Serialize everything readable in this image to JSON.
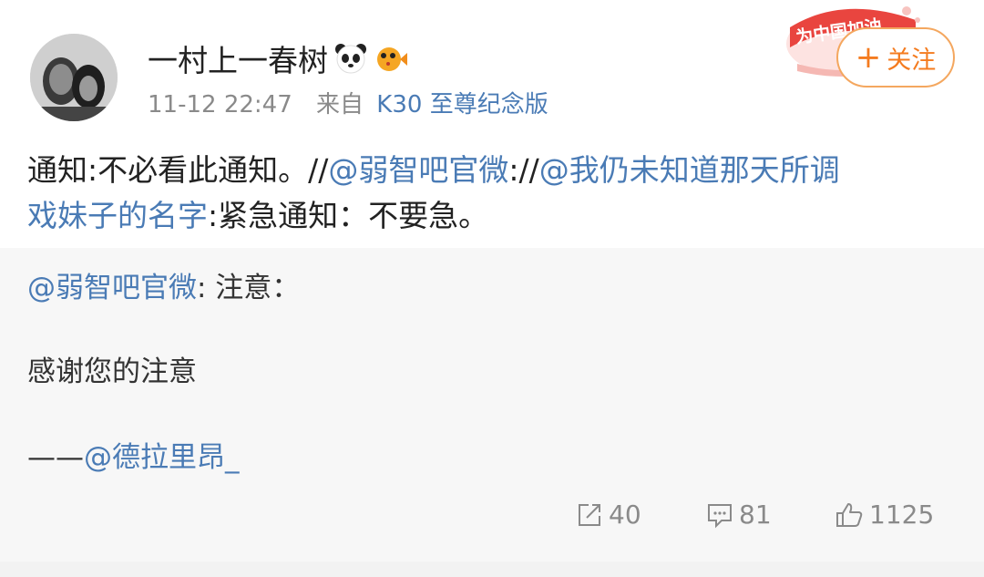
{
  "user": {
    "name": "一村上一春树",
    "time": "11-12 22:47",
    "source_prefix": "来自",
    "source": "K30 至尊纪念版"
  },
  "badge": {
    "text": "为中国加油"
  },
  "follow_label": "关注",
  "post": {
    "p1": "通知:不必看此通知。//",
    "mention1": "@弱智吧官微",
    "p2": "://",
    "mention2_line1": "@我仍未知道那天所调",
    "mention2_line2": "戏妹子的名字",
    "p3": ":紧急通知：不要急。"
  },
  "retweet": {
    "mention": "@弱智吧官微",
    "heading": ": 注意：",
    "body": "感谢您的注意",
    "dash": "——",
    "credit": "@德拉里昂_"
  },
  "actions": {
    "repost": "40",
    "comment": "81",
    "like": "1125"
  },
  "colors": {
    "link": "#4a7bb5",
    "follow": "#f47b1f",
    "gray": "#8a8a8a"
  }
}
